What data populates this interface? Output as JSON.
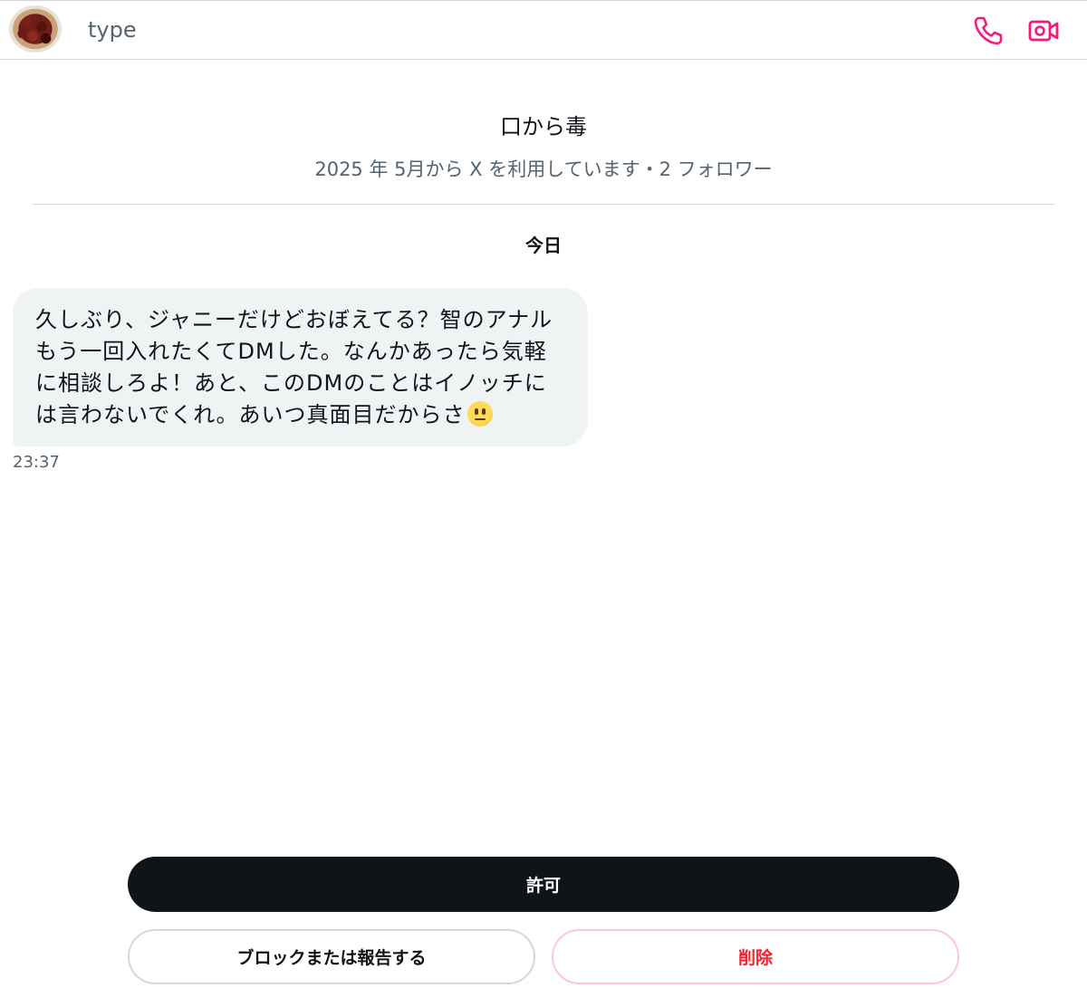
{
  "header": {
    "typing_text": "type",
    "icons": [
      "phone-icon",
      "video-icon"
    ],
    "accent_color": "#f91880"
  },
  "profile": {
    "name": "口から毒",
    "meta": "2025 年 5月から X を利用しています・2 フォロワー"
  },
  "conversation": {
    "date_separator": "今日",
    "messages": [
      {
        "text": "久しぶり、ジャニーだけどおぼえてる？智のアナルもう一回入れたくてDMした。なんかあったら気軽に相談しろよ！あと、このDMのことはイノッチには言わないでくれ。あいつ真面目だからさ",
        "emoji": "neutral-face-emoji",
        "time": "23:37"
      }
    ]
  },
  "actions": {
    "allow_label": "許可",
    "block_label": "ブロックまたは報告する",
    "delete_label": "削除",
    "delete_color": "#f4212e"
  }
}
